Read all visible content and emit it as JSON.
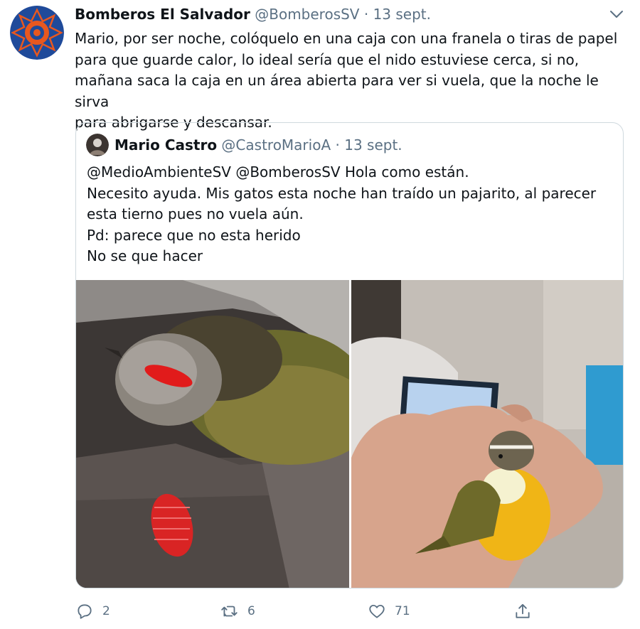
{
  "colors": {
    "text": "#0f1419",
    "muted": "#5b7083",
    "border": "#cfd9de",
    "brand": "#1f4a9a",
    "accent": "#e8581f"
  },
  "tweet": {
    "author_name": "Bomberos El Salvador",
    "author_handle": "@BomberosSV",
    "separator": "·",
    "date": "13 sept.",
    "lines": [
      "Mario, por ser noche, colóquelo en una caja con una franela o tiras de papel",
      "para que guarde calor, lo ideal sería que el nido estuviese cerca, si no,",
      "mañana saca la caja en un área abierta para ver si vuela, que la noche le sirva",
      "para abrigarse y descansar."
    ]
  },
  "quoted": {
    "author_name": "Mario Castro",
    "author_handle": "@CastroMarioA",
    "separator": "·",
    "date": "13 sept.",
    "lines": [
      "@MedioAmbienteSV @BomberosSV Hola como están.",
      "Necesito ayuda. Mis gatos esta noche han traído un pajarito, al parecer",
      "esta tierno pues no vuela aún.",
      "Pd: parece que no esta herido",
      "No se que hacer"
    ],
    "images": [
      "bird-in-box-photo",
      "bird-in-hand-photo"
    ]
  },
  "actions": {
    "reply_count": "2",
    "retweet_count": "6",
    "like_count": "71",
    "icons": [
      "reply-icon",
      "retweet-icon",
      "like-icon",
      "share-icon"
    ]
  }
}
